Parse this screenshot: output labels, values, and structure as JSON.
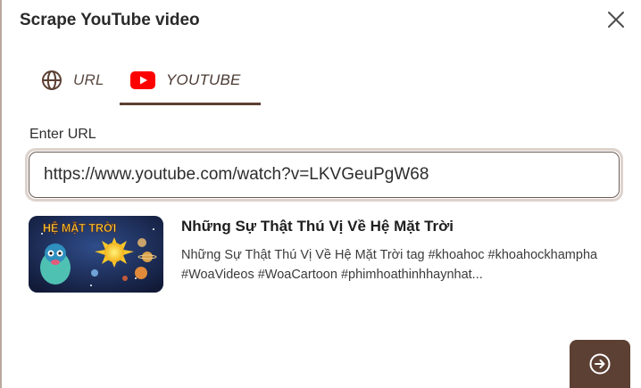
{
  "dialog": {
    "title": "Scrape YouTube video"
  },
  "tabs": [
    {
      "label": "URL",
      "icon": "globe-icon",
      "active": false
    },
    {
      "label": "YOUTUBE",
      "icon": "youtube-icon",
      "active": true
    }
  ],
  "form": {
    "label": "Enter URL",
    "value": "https://www.youtube.com/watch?v=LKVGeuPgW68"
  },
  "video": {
    "thumbnail_text": "HỆ MẶT TRỜI",
    "title": "Những Sự Thật Thú Vị Về Hệ Mặt Trời",
    "description": "Những Sự Thật Thú Vị Về Hệ Mặt Trời tag #khoahoc #khoahockhampha #WoaVideos #WoaCartoon #phimhoathinhhaynhat..."
  },
  "colors": {
    "accent": "#5c4033",
    "youtube_red": "#ff0000",
    "input_focus_ring": "#ddd2cc"
  }
}
